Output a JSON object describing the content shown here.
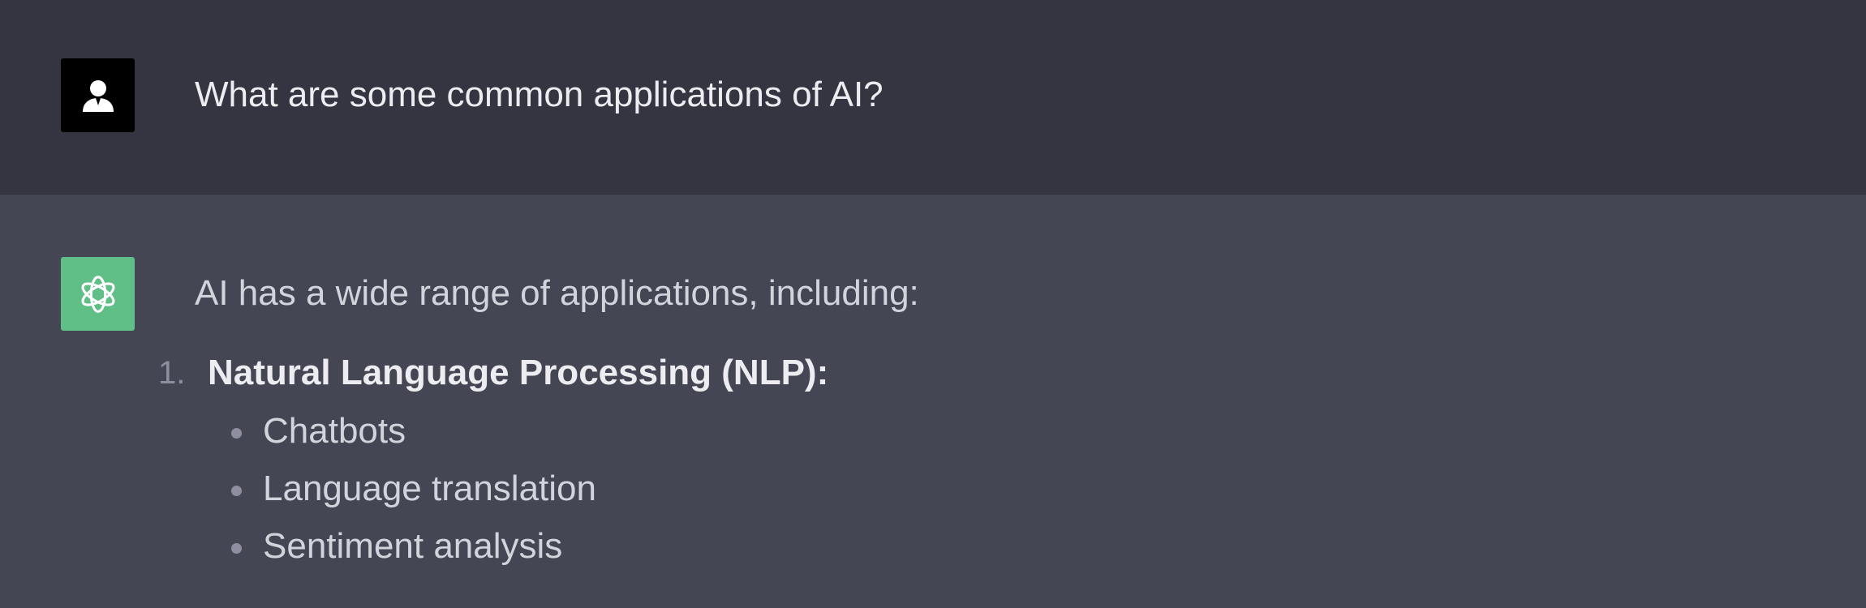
{
  "conversation": {
    "user": {
      "avatar_icon": "user-silhouette-icon",
      "message": "What are some common applications of AI?"
    },
    "assistant": {
      "avatar_icon": "openai-logo-icon",
      "avatar_color": "#5fbf87",
      "intro": "AI has a wide range of applications, including:",
      "ordered_list": [
        {
          "number": "1.",
          "title": "Natural Language Processing (NLP):",
          "items": [
            "Chatbots",
            "Language translation",
            "Sentiment analysis"
          ]
        }
      ]
    }
  },
  "colors": {
    "user_row_bg": "#343541",
    "assistant_row_bg": "#444654"
  }
}
